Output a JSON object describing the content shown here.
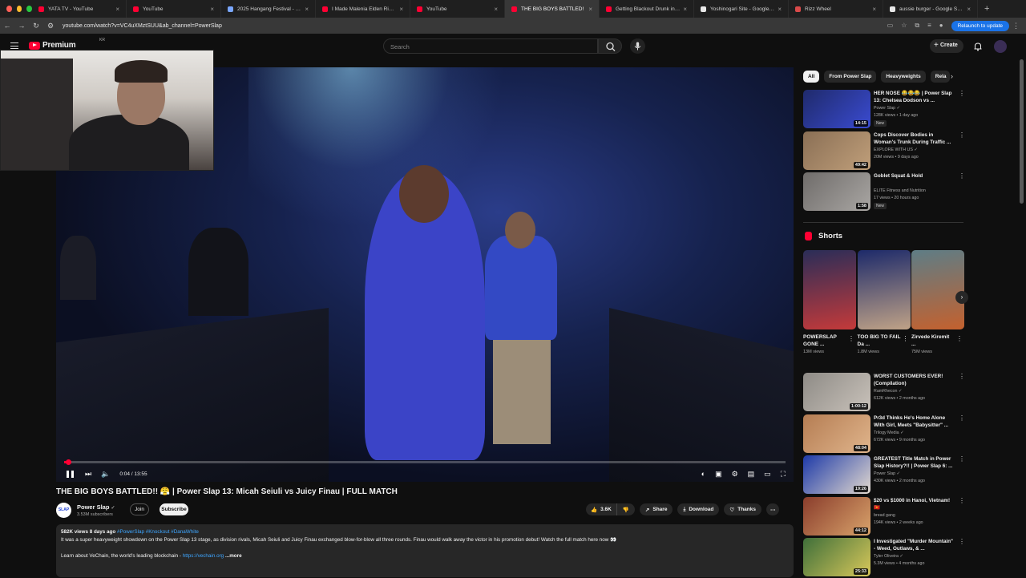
{
  "browser": {
    "tabs": [
      {
        "title": "YATA TV - YouTube",
        "color": "#ff0033",
        "active": false
      },
      {
        "title": "YouTube",
        "color": "#ff0033",
        "active": false
      },
      {
        "title": "2025 Hangang Festival - Han",
        "color": "#7aa7ff",
        "active": false
      },
      {
        "title": "I Made Malenia Elden Ring - ...",
        "color": "#ff0033",
        "active": false
      },
      {
        "title": "YouTube",
        "color": "#ff0033",
        "active": false
      },
      {
        "title": "THE BIG BOYS BATTLED!",
        "color": "#ff0033",
        "active": true
      },
      {
        "title": "Getting Blackout Drunk in M...",
        "color": "#ff0033",
        "active": false
      },
      {
        "title": "Yoshinogari Site - Google Se...",
        "color": "#e8e8e8",
        "active": false
      },
      {
        "title": "Rizz Wheel",
        "color": "#d94a4a",
        "active": false
      },
      {
        "title": "aussie burger - Google Search",
        "color": "#e8e8e8",
        "active": false
      }
    ],
    "url": "youtube.com/watch?v=VC4uXMztSUU&ab_channel=PowerSlap",
    "relaunch_label": "Relaunch to update"
  },
  "header": {
    "logo_text": "Premium",
    "logo_region": "KR",
    "search_placeholder": "Search",
    "create_label": "Create"
  },
  "player": {
    "current_time": "0:04",
    "duration": "13:55",
    "time_text": "0:04 / 13:55",
    "progress_fraction": 0.005
  },
  "video": {
    "title": "THE BIG BOYS BATTLED!! 😤 | Power Slap 13: Micah Seiuli vs Juicy Finau | FULL MATCH",
    "channel": "Power Slap",
    "channel_avatar_text": "SLAP",
    "subscribers": "3.53M subscribers",
    "join_label": "Join",
    "subscribe_label": "Subscribe",
    "likes": "3.6K",
    "share_label": "Share",
    "download_label": "Download",
    "thanks_label": "Thanks"
  },
  "description": {
    "meta": "582K views  8 days ago",
    "tags": "#PowerSlap #Knockout #DanaWhite",
    "body": "It was a super heavyweight showdown on the Power Slap 13 stage, as division rivals, Micah Seiuli and Juicy Finau exchanged blow-for-blow all three rounds. Finau would walk away the victor in his promotion debut! Watch the full match here now 👀",
    "learn": "Learn about VeChain, the world's leading blockchain - ",
    "link": "https://vechain.org",
    "more": "...more"
  },
  "chips": [
    "All",
    "From Power Slap",
    "Heavyweights",
    "Rela"
  ],
  "recommendations_top": [
    {
      "title": "HER NOSE 😂😂😂 | Power Slap 13: Chelsea Dodson vs ...",
      "channel": "Power Slap ✓",
      "meta": "128K views • 1 day ago",
      "badge": "New",
      "duration": "14:15",
      "colors": [
        "#1f2a6b",
        "#3a4bd1"
      ]
    },
    {
      "title": "Cops Discover Bodies in Woman's Trunk During Traffic ...",
      "channel": "EXPLORE WITH US ✓",
      "meta": "20M views • 9 days ago",
      "badge": "",
      "duration": "49:42",
      "colors": [
        "#8a6f55",
        "#c09f7a"
      ]
    },
    {
      "title": "Goblet Squat & Hold",
      "channel": "ELITE Fitness and Nutrition",
      "meta": "17 views • 20 hours ago",
      "badge": "New",
      "duration": "1:58",
      "colors": [
        "#6f6c6a",
        "#a9a6a3"
      ]
    }
  ],
  "shorts": {
    "heading": "Shorts",
    "items": [
      {
        "title": "POWERSLAP GONE ...",
        "views": "13M views",
        "colors": [
          "#2a2d58",
          "#c43a3a"
        ]
      },
      {
        "title": "TOO BIG TO FAIL Da ...",
        "views": "1.8M views",
        "colors": [
          "#1d2a6a",
          "#bfa287"
        ]
      },
      {
        "title": "Zirvede Kiremit ...",
        "views": "75M views",
        "colors": [
          "#5e7d86",
          "#c4612e"
        ]
      }
    ]
  },
  "recommendations_bottom": [
    {
      "title": "WORST CUSTOMERS EVER! (Compilation)",
      "channel": "RamRhecon ✓",
      "meta": "612K views • 2 months ago",
      "badge": "",
      "duration": "1:00:12",
      "colors": [
        "#8e8b86",
        "#c9c2ba"
      ]
    },
    {
      "title": "Pr3d Thinks He's Home Alone With Girl, Meets \"Babysitter\" ...",
      "channel": "Trilogy Media ✓",
      "meta": "672K views • 9 months ago",
      "badge": "",
      "duration": "48:04",
      "colors": [
        "#b57d53",
        "#e0b58c"
      ]
    },
    {
      "title": "GREATEST Title Match in Power Slap History?!! | Power Slap 6: ...",
      "channel": "Power Slap ✓",
      "meta": "430K views • 2 months ago",
      "badge": "",
      "duration": "19:26",
      "colors": [
        "#1e3aa8",
        "#e2d9cf"
      ]
    },
    {
      "title": "$20 vs $1000 in Hanoi, Vietnam! 🇻🇳",
      "channel": "bread gang",
      "meta": "194K views • 2 weeks ago",
      "badge": "",
      "duration": "44:12",
      "colors": [
        "#8a3d2c",
        "#d9a36b"
      ]
    },
    {
      "title": "I Investigated \"Murder Mountain\" - Weed, Outlaws, & ...",
      "channel": "Tyler Oliveira ✓",
      "meta": "5.3M views • 4 months ago",
      "badge": "",
      "duration": "25:33",
      "colors": [
        "#3f6f3a",
        "#d8c85a"
      ]
    }
  ]
}
